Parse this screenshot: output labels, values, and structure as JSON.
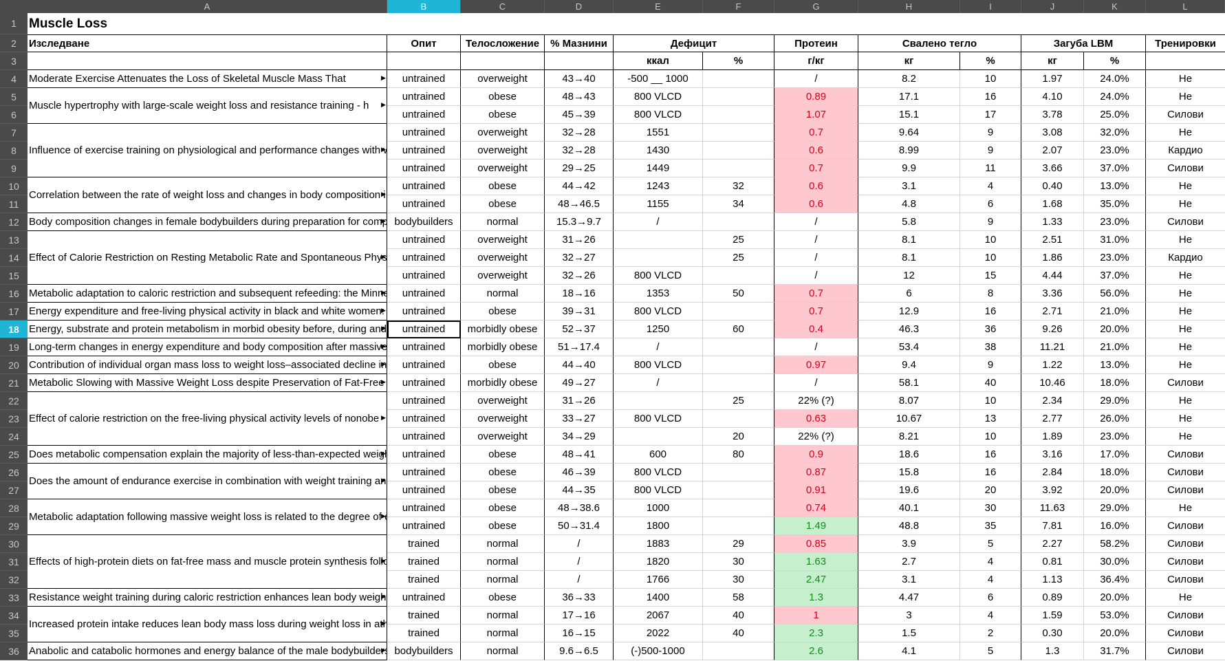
{
  "columns": [
    "A",
    "B",
    "C",
    "D",
    "E",
    "F",
    "G",
    "H",
    "I",
    "J",
    "K",
    "L"
  ],
  "selected_column": "B",
  "selected_row": 18,
  "title": "Muscle Loss",
  "header": {
    "A": "Изследване",
    "B": "Опит",
    "C": "Телосложение",
    "D": "% Мазнини",
    "E": "Дефицит",
    "G": "Протеин",
    "H": "Свалено тегло",
    "J": "Загуба LBM",
    "L": "Тренировки"
  },
  "subheader": {
    "E": "ккал",
    "F": "%",
    "G": "г/кг",
    "H": "кг",
    "I": "%",
    "J": "кг",
    "K": "%"
  },
  "studies": [
    {
      "row": 4,
      "span": 1,
      "text": "Moderate Exercise Attenuates the Loss of Skeletal Muscle Mass That"
    },
    {
      "row": 5,
      "span": 2,
      "text": "Muscle hypertrophy with large-scale weight loss and resistance training - h"
    },
    {
      "row": 7,
      "span": 3,
      "text": "Influence of exercise training on physiological and performance changes with w"
    },
    {
      "row": 10,
      "span": 2,
      "text": "Correlation between the rate of weight loss and changes in body composition i"
    },
    {
      "row": 12,
      "span": 1,
      "text": "Body composition changes in female bodybuilders during preparation for compe"
    },
    {
      "row": 13,
      "span": 3,
      "text": "Effect of Calorie Restriction on Resting Metabolic Rate and Spontaneous Physic"
    },
    {
      "row": 16,
      "span": 1,
      "text": "Metabolic adaptation to caloric restriction and subsequent refeeding: the Minnes"
    },
    {
      "row": 17,
      "span": 1,
      "text": "Energy expenditure and free-living physical activity in black and white women: c"
    },
    {
      "row": 18,
      "span": 1,
      "text": "Energy, substrate and protein metabolism in morbid obesity before, during and a"
    },
    {
      "row": 19,
      "span": 1,
      "text": "Long-term changes in energy expenditure and body composition after massive w"
    },
    {
      "row": 20,
      "span": 1,
      "text": "Contribution of individual organ mass loss to weight loss–associated decline in r"
    },
    {
      "row": 21,
      "span": 1,
      "text": "Metabolic Slowing with Massive Weight Loss despite Preservation of Fat-Free M"
    },
    {
      "row": 22,
      "span": 3,
      "text": "Effect of calorie restriction on the free-living physical activity levels of nonobe"
    },
    {
      "row": 25,
      "span": 1,
      "text": "Does metabolic compensation explain the majority of less-than-expected weight"
    },
    {
      "row": 26,
      "span": 2,
      "text": "Does the amount of endurance exercise in combination with weight training and"
    },
    {
      "row": 28,
      "span": 2,
      "text": "Metabolic adaptation following massive weight loss is related to the degree of e"
    },
    {
      "row": 30,
      "span": 3,
      "text": "Effects of high-protein diets on fat-free mass and muscle protein synthesis follo"
    },
    {
      "row": 33,
      "span": 1,
      "text": "Resistance weight training during caloric restriction enhances lean body weight"
    },
    {
      "row": 34,
      "span": 2,
      "text": "Increased protein intake reduces lean body mass loss during weight loss in athl"
    },
    {
      "row": 36,
      "span": 1,
      "text": "Anabolic and catabolic hormones and energy balance of the male bodybuilders"
    }
  ],
  "rows": [
    {
      "n": 4,
      "B": "untrained",
      "C": "overweight",
      "D": "43→40",
      "E": "-500 __ 1000",
      "F": "",
      "G": "/",
      "Gc": "",
      "H": "8.2",
      "I": "10",
      "J": "1.97",
      "K": "24.0%",
      "L": "Не"
    },
    {
      "n": 5,
      "B": "untrained",
      "C": "obese",
      "D": "48→43",
      "E": "800 VLCD",
      "F": "",
      "G": "0.89",
      "Gc": "red",
      "H": "17.1",
      "I": "16",
      "J": "4.10",
      "K": "24.0%",
      "L": "Не"
    },
    {
      "n": 6,
      "B": "untrained",
      "C": "obese",
      "D": "45→39",
      "E": "800 VLCD",
      "F": "",
      "G": "1.07",
      "Gc": "red",
      "H": "15.1",
      "I": "17",
      "J": "3.78",
      "K": "25.0%",
      "L": "Силови"
    },
    {
      "n": 7,
      "B": "untrained",
      "C": "overweight",
      "D": "32→28",
      "E": "1551",
      "F": "",
      "G": "0.7",
      "Gc": "red",
      "H": "9.64",
      "I": "9",
      "J": "3.08",
      "K": "32.0%",
      "L": "Не"
    },
    {
      "n": 8,
      "B": "untrained",
      "C": "overweight",
      "D": "32→28",
      "E": "1430",
      "F": "",
      "G": "0.6",
      "Gc": "red",
      "H": "8.99",
      "I": "9",
      "J": "2.07",
      "K": "23.0%",
      "L": "Кардио"
    },
    {
      "n": 9,
      "B": "untrained",
      "C": "overweight",
      "D": "29→25",
      "E": "1449",
      "F": "",
      "G": "0.7",
      "Gc": "red",
      "H": "9.9",
      "I": "11",
      "J": "3.66",
      "K": "37.0%",
      "L": "Силови"
    },
    {
      "n": 10,
      "B": "untrained",
      "C": "obese",
      "D": "44→42",
      "E": "1243",
      "F": "32",
      "G": "0.6",
      "Gc": "red",
      "H": "3.1",
      "I": "4",
      "J": "0.40",
      "K": "13.0%",
      "L": "Не"
    },
    {
      "n": 11,
      "B": "untrained",
      "C": "obese",
      "D": "48→46.5",
      "E": "1155",
      "F": "34",
      "G": "0.6",
      "Gc": "red",
      "H": "4.8",
      "I": "6",
      "J": "1.68",
      "K": "35.0%",
      "L": "Не"
    },
    {
      "n": 12,
      "B": "bodybuilders",
      "C": "normal",
      "D": "15.3→9.7",
      "E": "/",
      "F": "",
      "G": "/",
      "Gc": "",
      "H": "5.8",
      "I": "9",
      "J": "1.33",
      "K": "23.0%",
      "L": "Силови"
    },
    {
      "n": 13,
      "B": "untrained",
      "C": "overweight",
      "D": "31→26",
      "E": "",
      "F": "25",
      "G": "/",
      "Gc": "",
      "H": "8.1",
      "I": "10",
      "J": "2.51",
      "K": "31.0%",
      "L": "Не"
    },
    {
      "n": 14,
      "B": "untrained",
      "C": "overweight",
      "D": "32→27",
      "E": "",
      "F": "25",
      "G": "/",
      "Gc": "",
      "H": "8.1",
      "I": "10",
      "J": "1.86",
      "K": "23.0%",
      "L": "Кардио"
    },
    {
      "n": 15,
      "B": "untrained",
      "C": "overweight",
      "D": "32→26",
      "E": "800  VLCD",
      "F": "",
      "G": "/",
      "Gc": "",
      "H": "12",
      "I": "15",
      "J": "4.44",
      "K": "37.0%",
      "L": "Не"
    },
    {
      "n": 16,
      "B": "untrained",
      "C": "normal",
      "D": "18→16",
      "E": "1353",
      "F": "50",
      "G": "0.7",
      "Gc": "red",
      "H": "6",
      "I": "8",
      "J": "3.36",
      "K": "56.0%",
      "L": "Не"
    },
    {
      "n": 17,
      "B": "untrained",
      "C": "obese",
      "D": "39→31",
      "E": "800  VLCD",
      "F": "",
      "G": "0.7",
      "Gc": "red",
      "H": "12.9",
      "I": "16",
      "J": "2.71",
      "K": "21.0%",
      "L": "Не"
    },
    {
      "n": 18,
      "B": "untrained",
      "C": "morbidly obese",
      "D": "52→37",
      "E": "1250",
      "F": "60",
      "G": "0.4",
      "Gc": "red",
      "H": "46.3",
      "I": "36",
      "J": "9.26",
      "K": "20.0%",
      "L": "Не"
    },
    {
      "n": 19,
      "B": "untrained",
      "C": "morbidly obese",
      "D": "51→17.4",
      "E": "/",
      "F": "",
      "G": "/",
      "Gc": "",
      "H": "53.4",
      "I": "38",
      "J": "11.21",
      "K": "21.0%",
      "L": "Не"
    },
    {
      "n": 20,
      "B": "untrained",
      "C": "obese",
      "D": "44→40",
      "E": "800  VLCD",
      "F": "",
      "G": "0.97",
      "Gc": "red",
      "H": "9.4",
      "I": "9",
      "J": "1.22",
      "K": "13.0%",
      "L": "Не"
    },
    {
      "n": 21,
      "B": "untrained",
      "C": "morbidly obese",
      "D": "49→27",
      "E": "/",
      "F": "",
      "G": "/",
      "Gc": "",
      "H": "58.1",
      "I": "40",
      "J": "10.46",
      "K": "18.0%",
      "L": "Силови"
    },
    {
      "n": 22,
      "B": "untrained",
      "C": "overweight",
      "D": "31→26",
      "E": "",
      "F": "25",
      "G": "22% (?)",
      "Gc": "",
      "H": "8.07",
      "I": "10",
      "J": "2.34",
      "K": "29.0%",
      "L": "Не"
    },
    {
      "n": 23,
      "B": "untrained",
      "C": "overweight",
      "D": "33→27",
      "E": "800  VLCD",
      "F": "",
      "G": "0.63",
      "Gc": "red",
      "H": "10.67",
      "I": "13",
      "J": "2.77",
      "K": "26.0%",
      "L": "Не"
    },
    {
      "n": 24,
      "B": "untrained",
      "C": "overweight",
      "D": "34→29",
      "E": "",
      "F": "20",
      "G": "22% (?)",
      "Gc": "",
      "H": "8.21",
      "I": "10",
      "J": "1.89",
      "K": "23.0%",
      "L": "Не"
    },
    {
      "n": 25,
      "B": "untrained",
      "C": "obese",
      "D": "48→41",
      "E": "600",
      "F": "80",
      "G": "0.9",
      "Gc": "red",
      "H": "18.6",
      "I": "16",
      "J": "3.16",
      "K": "17.0%",
      "L": "Силови"
    },
    {
      "n": 26,
      "B": "untrained",
      "C": "obese",
      "D": "46→39",
      "E": "800  VLCD",
      "F": "",
      "G": "0.87",
      "Gc": "red",
      "H": "15.8",
      "I": "16",
      "J": "2.84",
      "K": "18.0%",
      "L": "Силови"
    },
    {
      "n": 27,
      "B": "untrained",
      "C": "obese",
      "D": "44→35",
      "E": "800  VLCD",
      "F": "",
      "G": "0.91",
      "Gc": "red",
      "H": "19.6",
      "I": "20",
      "J": "3.92",
      "K": "20.0%",
      "L": "Силови"
    },
    {
      "n": 28,
      "B": "untrained",
      "C": "obese",
      "D": "48→38.6",
      "E": "1000",
      "F": "",
      "G": "0.74",
      "Gc": "red",
      "H": "40.1",
      "I": "30",
      "J": "11.63",
      "K": "29.0%",
      "L": "Не"
    },
    {
      "n": 29,
      "B": "untrained",
      "C": "obese",
      "D": "50→31.4",
      "E": "1800",
      "F": "",
      "G": "1.49",
      "Gc": "green",
      "H": "48.8",
      "I": "35",
      "J": "7.81",
      "K": "16.0%",
      "L": "Силови"
    },
    {
      "n": 30,
      "B": "trained",
      "C": "normal",
      "D": "/",
      "E": "1883",
      "F": "29",
      "G": "0.85",
      "Gc": "red",
      "H": "3.9",
      "I": "5",
      "J": "2.27",
      "K": "58.2%",
      "L": "Силови"
    },
    {
      "n": 31,
      "B": "trained",
      "C": "normal",
      "D": "/",
      "E": "1820",
      "F": "30",
      "G": "1.63",
      "Gc": "green",
      "H": "2.7",
      "I": "4",
      "J": "0.81",
      "K": "30.0%",
      "L": "Силови"
    },
    {
      "n": 32,
      "B": "trained",
      "C": "normal",
      "D": "/",
      "E": "1766",
      "F": "30",
      "G": "2.47",
      "Gc": "green",
      "H": "3.1",
      "I": "4",
      "J": "1.13",
      "K": "36.4%",
      "L": "Силови"
    },
    {
      "n": 33,
      "B": "untrained",
      "C": "obese",
      "D": "36→33",
      "E": "1400",
      "F": "58",
      "G": "1.3",
      "Gc": "green",
      "H": "4.47",
      "I": "6",
      "J": "0.89",
      "K": "20.0%",
      "L": "Не"
    },
    {
      "n": 34,
      "B": "trained",
      "C": "normal",
      "D": "17→16",
      "E": "2067",
      "F": "40",
      "G": "1",
      "Gc": "red",
      "H": "3",
      "I": "4",
      "J": "1.59",
      "K": "53.0%",
      "L": "Силови"
    },
    {
      "n": 35,
      "B": "trained",
      "C": "normal",
      "D": "16→15",
      "E": "2022",
      "F": "40",
      "G": "2.3",
      "Gc": "green",
      "H": "1.5",
      "I": "2",
      "J": "0.30",
      "K": "20.0%",
      "L": "Силови"
    },
    {
      "n": 36,
      "B": "bodybuilders",
      "C": "normal",
      "D": "9.6→6.5",
      "E": "(-)500-1000",
      "F": "",
      "G": "2.6",
      "Gc": "green",
      "H": "4.1",
      "I": "5",
      "J": "1.3",
      "K": "31.7%",
      "L": "Силови"
    }
  ]
}
